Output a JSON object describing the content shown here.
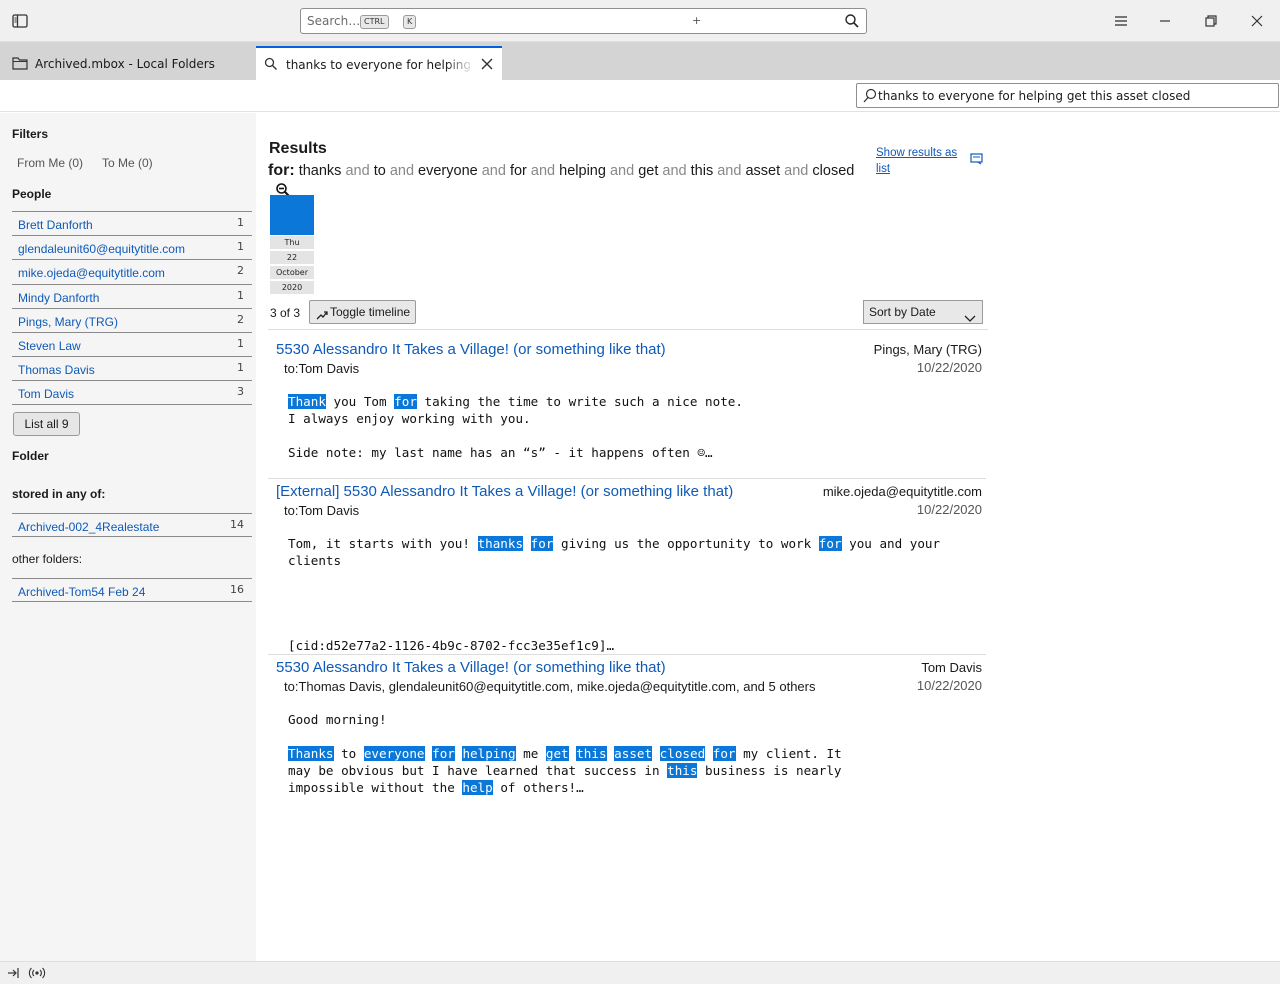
{
  "titlebar": {
    "search_placeholder": "Search…",
    "kbd1": "CTRL",
    "kbd_plus": "+",
    "kbd2": "K"
  },
  "tabs": [
    {
      "label": "Archived.mbox - Local Folders",
      "icon": "folder-icon"
    },
    {
      "label": "thanks to everyone for helping get this asset closed",
      "icon": "search-icon"
    }
  ],
  "quick_filter": {
    "value": "thanks to everyone for helping get this asset closed"
  },
  "sidebar": {
    "filters_title": "Filters",
    "from_me": "From Me  (0)",
    "to_me": "To Me  (0)",
    "people_title": "People",
    "people": [
      {
        "name": "Brett Danforth",
        "count": "1"
      },
      {
        "name": "glendaleunit60@equitytitle.com",
        "count": "1"
      },
      {
        "name": "mike.ojeda@equitytitle.com",
        "count": "2"
      },
      {
        "name": "Mindy Danforth",
        "count": "1"
      },
      {
        "name": "Pings, Mary (TRG)",
        "count": "2"
      },
      {
        "name": "Steven Law",
        "count": "1"
      },
      {
        "name": "Thomas Davis",
        "count": "1"
      },
      {
        "name": "Tom Davis",
        "count": "3"
      }
    ],
    "list_all": "List all 9",
    "folder_title": "Folder",
    "stored_title": "stored in any of:",
    "stored": [
      {
        "name": "Archived-002_4Realestate",
        "count": "14"
      }
    ],
    "other_title": "other folders:",
    "other": [
      {
        "name": "Archived-Tom54 Feb 24",
        "count": "16"
      }
    ]
  },
  "results": {
    "title": "Results",
    "for_label": "for:",
    "terms": [
      "thanks",
      "to",
      "everyone",
      "for",
      "helping",
      "get",
      "this",
      "asset",
      "closed"
    ],
    "and_word": "and",
    "show_as_list": "Show results as list",
    "timeline": {
      "day": "Thu",
      "date": "22",
      "month": "October",
      "year": "2020"
    },
    "count": "3 of 3",
    "toggle_timeline": "Toggle timeline",
    "sort": "Sort by Date"
  },
  "messages": [
    {
      "subject": "5530 Alessandro It Takes a Village! (or something like that)",
      "from": "Pings, Mary (TRG)",
      "date": "10/22/2020",
      "to": "to:Tom Davis"
    },
    {
      "subject": "[External] 5530 Alessandro It Takes a Village! (or something like that)",
      "from": "mike.ojeda@equitytitle.com",
      "date": "10/22/2020",
      "to": "to:Tom Davis"
    },
    {
      "subject": "5530 Alessandro It Takes a Village! (or something like that)",
      "from": "Tom Davis",
      "date": "10/22/2020",
      "to": "to:Thomas Davis, glendaleunit60@equitytitle.com, mike.ojeda@equitytitle.com, and 5 others"
    }
  ],
  "colors": {
    "accent": "#0b78d9",
    "link": "#0f5ab8",
    "tab_active_border": "#0060df"
  }
}
